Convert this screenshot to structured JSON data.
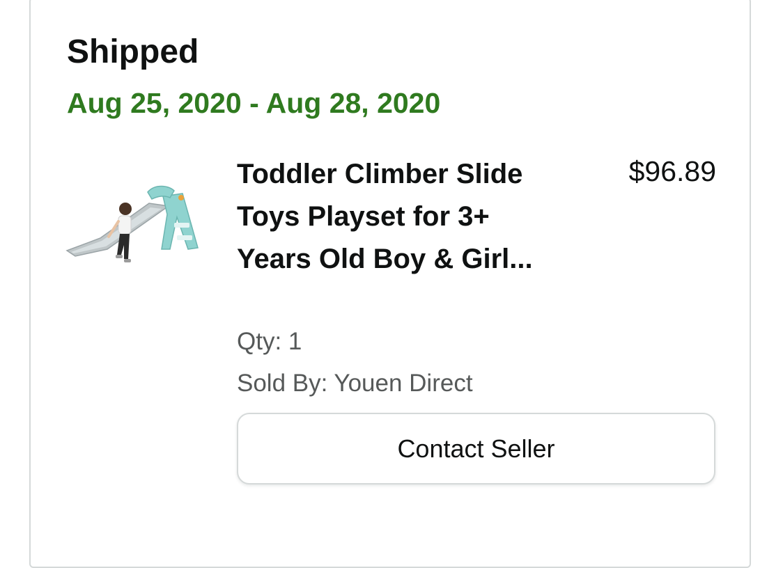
{
  "shipment": {
    "status": "Shipped",
    "date_range": "Aug 25, 2020 - Aug 28, 2020",
    "status_color": "#2f7a1f"
  },
  "item": {
    "title": "Toddler Climber Slide Toys Playset for 3+ Years Old Boy & Girl...",
    "price": "$96.89",
    "qty": "Qty: 1",
    "sold_by": "Sold By: Youen Direct",
    "image_icon": "slide-playset-image"
  },
  "actions": {
    "contact_seller_label": "Contact Seller"
  }
}
